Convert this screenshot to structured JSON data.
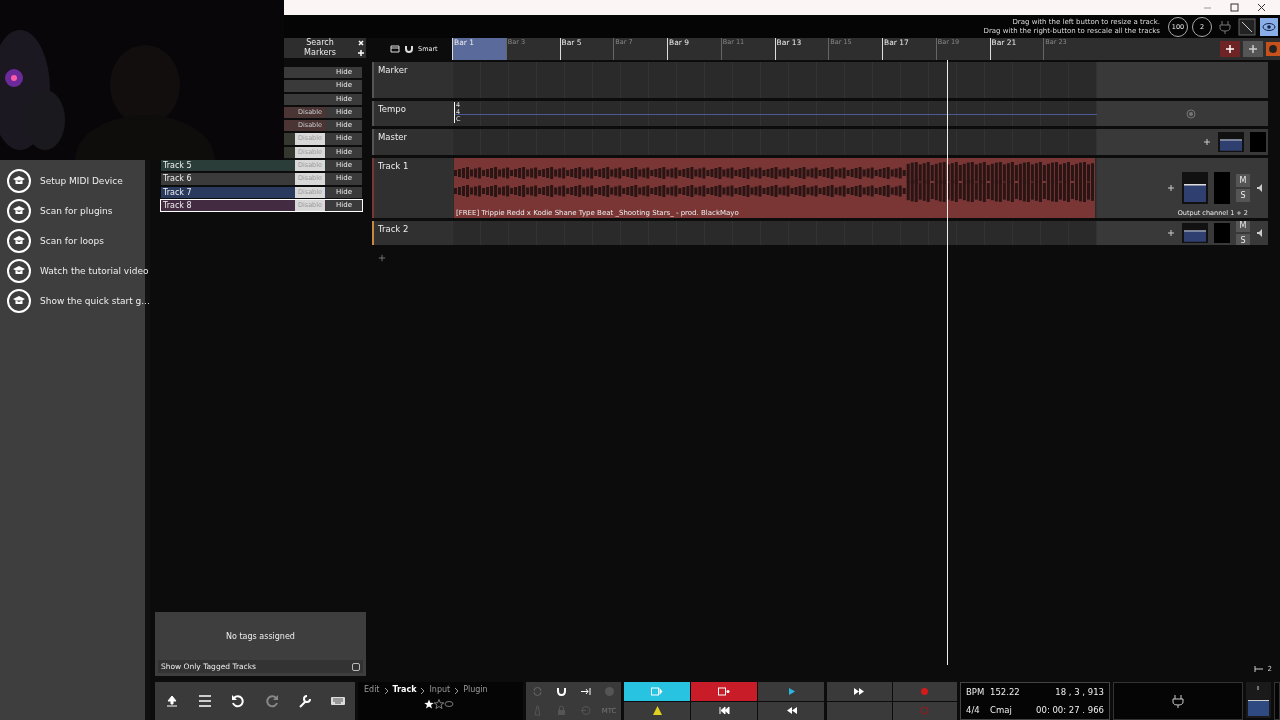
{
  "info_bar": {
    "hint_lines": [
      "Drag with the left button to resize a track.",
      "Drag with the right-button to rescale all the tracks"
    ],
    "knobs": [
      "100",
      "2"
    ]
  },
  "tutorial": {
    "items": [
      {
        "label": "Setup MIDI Device"
      },
      {
        "label": "Scan for plugins"
      },
      {
        "label": "Scan for loops"
      },
      {
        "label": "Watch the tutorial video"
      },
      {
        "label": "Show the quick start g..."
      }
    ]
  },
  "track_list": {
    "search": "Search",
    "markers": "Markers",
    "rows": [
      {
        "name": "",
        "color": "#3a3a3a",
        "disable": null,
        "hide": "Hide",
        "selected": false
      },
      {
        "name": "",
        "color": "#3a3a3a",
        "disable": null,
        "hide": "Hide",
        "selected": false
      },
      {
        "name": "",
        "color": "#3a3a3a",
        "disable": null,
        "hide": "Hide",
        "selected": false
      },
      {
        "name": "",
        "color": "#4a3434",
        "disable": {
          "label": "Disable",
          "lit": false
        },
        "hide": "Hide",
        "selected": false
      },
      {
        "name": "",
        "color": "#4a3434",
        "disable": {
          "label": "Disable",
          "lit": false
        },
        "hide": "Hide",
        "selected": false
      },
      {
        "name": "",
        "color": "#35382e",
        "disable": {
          "label": "Disable",
          "lit": true
        },
        "hide": "Hide",
        "selected": false
      },
      {
        "name": "",
        "color": "#33382f",
        "disable": {
          "label": "Disable",
          "lit": true
        },
        "hide": "Hide",
        "selected": false
      },
      {
        "name": "Track 5",
        "color": "#2b3d38",
        "disable": {
          "label": "Disable",
          "lit": true
        },
        "hide": "Hide",
        "selected": false
      },
      {
        "name": "Track 6",
        "color": "#3b3b3b",
        "disable": {
          "label": "Disable",
          "lit": true
        },
        "hide": "Hide",
        "selected": false
      },
      {
        "name": "Track 7",
        "color": "#2a3a5e",
        "disable": {
          "label": "Disable",
          "lit": true
        },
        "hide": "Hide",
        "selected": false
      },
      {
        "name": "Track 8",
        "color": "#432c42",
        "disable": {
          "label": "Disable",
          "lit": true
        },
        "hide": "Hide",
        "selected": true
      }
    ],
    "empty_text": "No tags assigned",
    "filter_label": "Show Only Tagged Tracks",
    "filter_checked": false
  },
  "toolbar": {
    "mode": "Smart"
  },
  "ruler": {
    "bars": [
      {
        "label": "Bar 1",
        "major": true
      },
      {
        "label": "Bar 3",
        "major": false
      },
      {
        "label": "Bar 5",
        "major": true
      },
      {
        "label": "Bar 7",
        "major": false
      },
      {
        "label": "Bar 9",
        "major": true
      },
      {
        "label": "Bar 11",
        "major": false
      },
      {
        "label": "Bar 13",
        "major": true
      },
      {
        "label": "Bar 15",
        "major": false
      },
      {
        "label": "Bar 17",
        "major": true
      },
      {
        "label": "Bar 19",
        "major": false
      },
      {
        "label": "Bar 21",
        "major": true
      },
      {
        "label": "Bar 23",
        "major": false
      }
    ]
  },
  "tracks": [
    {
      "kind": "marker",
      "name": "Marker"
    },
    {
      "kind": "tempo",
      "name": "Tempo",
      "signature": [
        "4",
        "4",
        "C"
      ]
    },
    {
      "kind": "master",
      "name": "Master"
    },
    {
      "kind": "audio",
      "name": "Track 1",
      "clip": "[FREE] Trippie Redd x Kodie Shane Type Beat _Shooting Stars_ - prod. BlackMayo",
      "output": "Output channel 1 + 2",
      "mute": "M",
      "solo": "S"
    },
    {
      "kind": "empty",
      "name": "Track 2",
      "mute": "M",
      "solo": "S"
    }
  ],
  "zoom": "2",
  "breadcrumb": [
    {
      "label": "Edit",
      "selected": false
    },
    {
      "label": "Track",
      "selected": true
    },
    {
      "label": "Input",
      "selected": false
    },
    {
      "label": "Plugin",
      "selected": false
    }
  ],
  "mtc": "MTC",
  "display": {
    "bpm_label": "BPM",
    "bpm": "152.22",
    "position": "18 , 3 , 913",
    "signature": "4/4",
    "key": "Cmaj",
    "time": "00: 00: 27 . 966"
  }
}
